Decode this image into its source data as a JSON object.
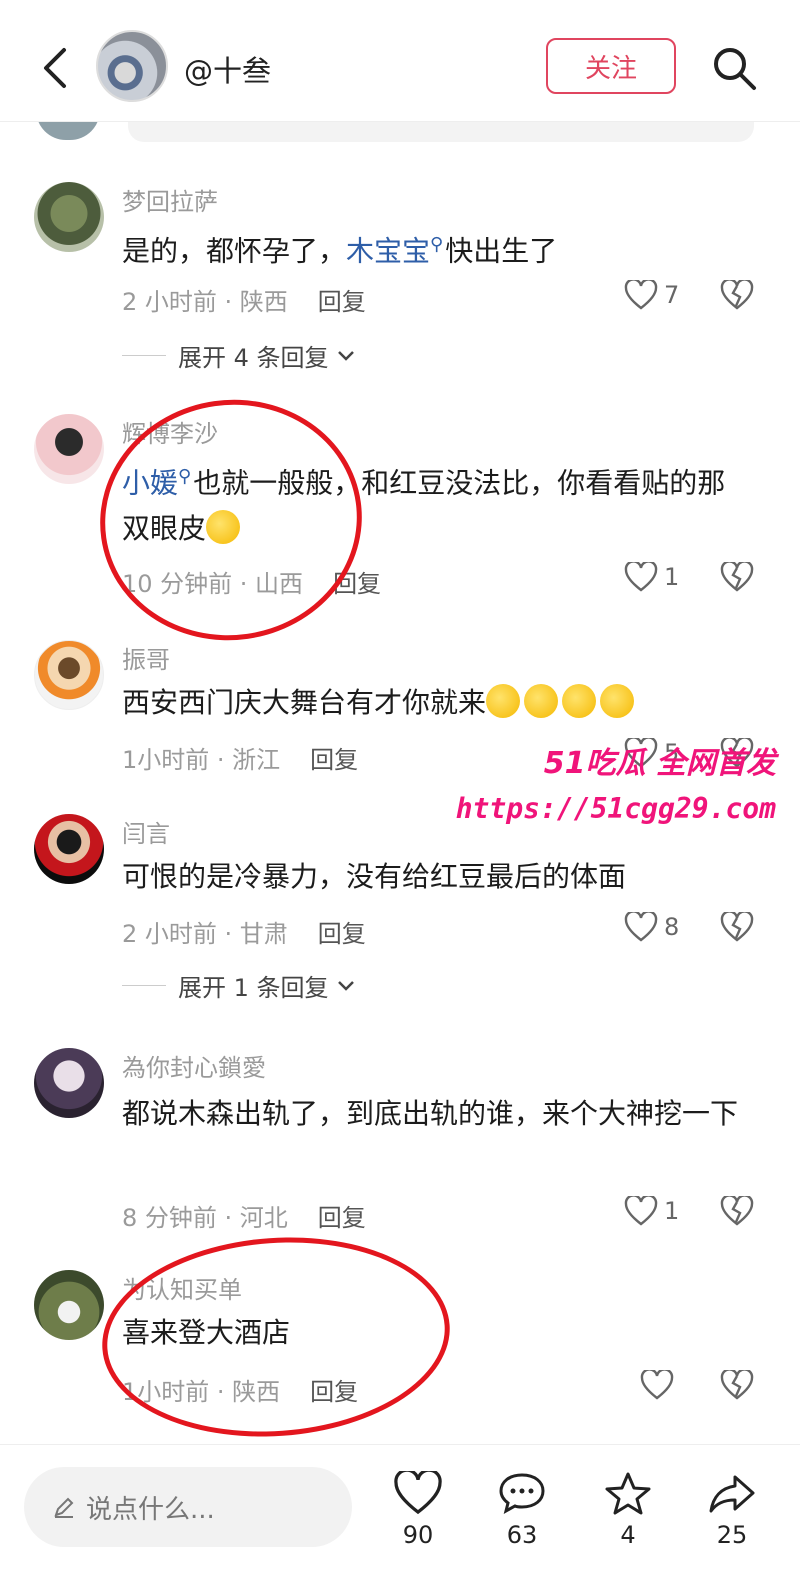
{
  "header": {
    "username": "@十叁",
    "follow_label": "关注"
  },
  "comments": [
    {
      "name": "梦回拉萨",
      "text_before": "是的，都怀孕了，",
      "mention": "木宝宝",
      "text_after": "快出生了",
      "time": "2 小时前 · 陕西",
      "reply": "回复",
      "likes": "7",
      "expand": "展开 4 条回复"
    },
    {
      "name": "辉博李沙",
      "mention": "小媛",
      "text_after": "也就一般般，和红豆没法比，你看看贴的那双眼皮",
      "time": "10 分钟前 · 山西",
      "reply": "回复",
      "likes": "1"
    },
    {
      "name": "振哥",
      "text": "西安西门庆大舞台有才你就来",
      "time": "1小时前 · 浙江",
      "reply": "回复",
      "likes": "5"
    },
    {
      "name": "闫言",
      "text": "可恨的是冷暴力，没有给红豆最后的体面",
      "time": "2 小时前 · 甘肃",
      "reply": "回复",
      "likes": "8",
      "expand": "展开 1 条回复"
    },
    {
      "name": "為你封心鎖愛",
      "text": "都说木森出轨了，到底出轨的谁，来个大神挖一下",
      "time": "8 分钟前 · 河北",
      "reply": "回复",
      "likes": "1"
    },
    {
      "name": "为认知买单",
      "text": "喜来登大酒店",
      "time": "1小时前 · 陕西",
      "reply": "回复",
      "likes": ""
    }
  ],
  "watermark": {
    "brand": "51吃瓜 全网首发",
    "url": "https://51cgg29.com"
  },
  "bottom": {
    "input_placeholder": "说点什么...",
    "like_count": "90",
    "comment_count": "63",
    "star_count": "4",
    "share_count": "25"
  },
  "colors": {
    "accent": "#e0455f",
    "mention": "#2e5ea8",
    "annotation": "#e3161e",
    "watermark": "#f0147a"
  },
  "icons": [
    "back-arrow-icon",
    "search-icon",
    "heart-icon",
    "broken-heart-icon",
    "chevron-down-icon",
    "pencil-icon",
    "comment-bubble-icon",
    "star-icon",
    "share-icon"
  ]
}
